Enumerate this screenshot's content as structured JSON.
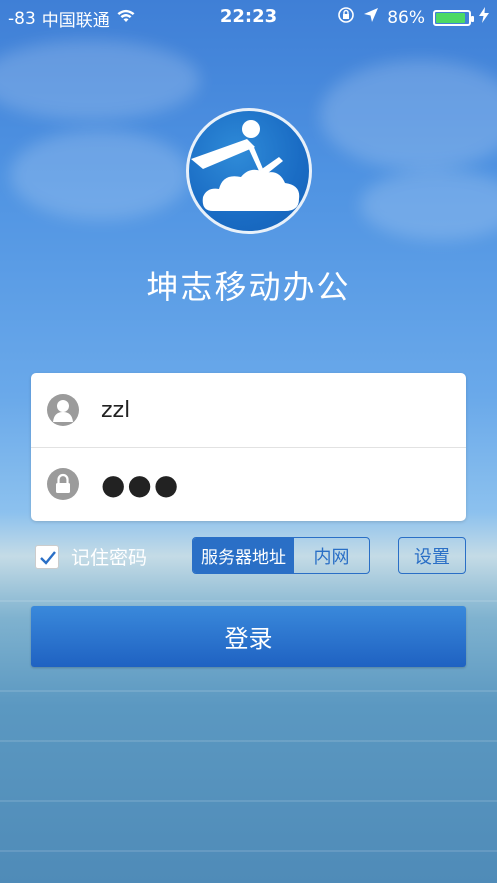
{
  "status_bar": {
    "signal": "-83",
    "carrier": "中国联通",
    "time": "22:23",
    "battery": "86%",
    "battery_level": 0.86
  },
  "app": {
    "title": "坤志移动办公"
  },
  "form": {
    "username_value": "zzl",
    "password_masked": "●●●"
  },
  "options": {
    "remember_label": "记住密码",
    "remember_checked": true,
    "server_label": "服务器地址",
    "server_mode": "内网",
    "settings_label": "设置"
  },
  "login_label": "登录",
  "colors": {
    "accent": "#2a6fc6",
    "battery": "#4cd964"
  }
}
